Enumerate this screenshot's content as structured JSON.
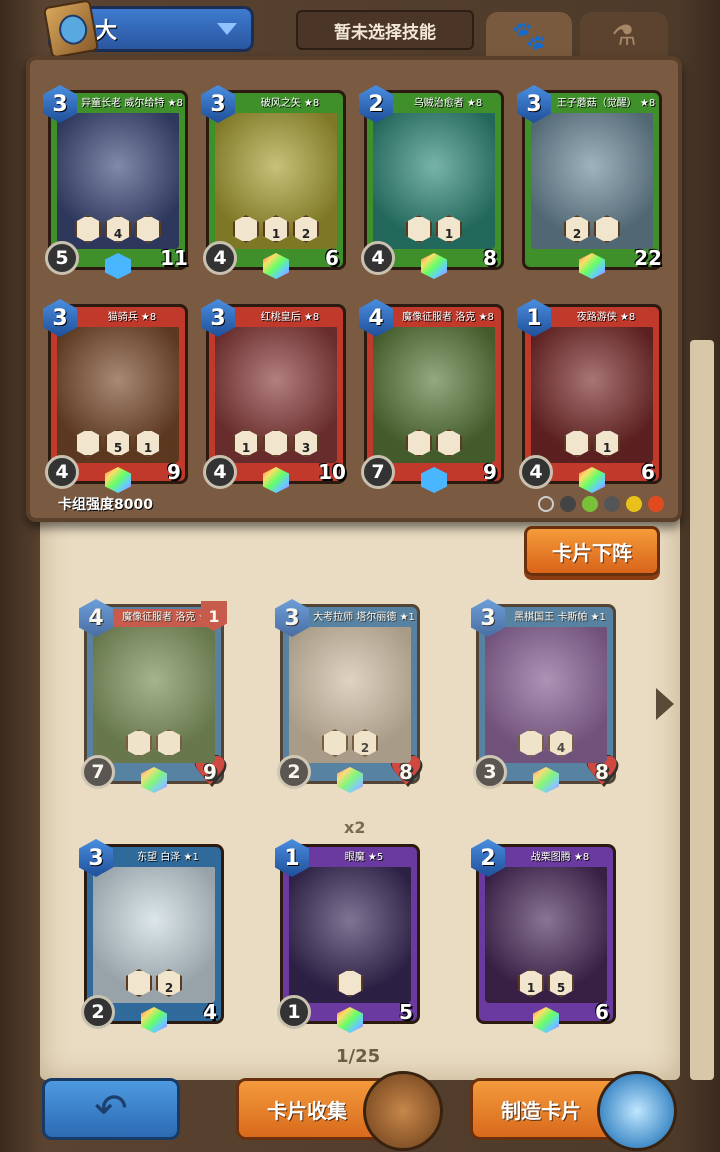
{
  "header": {
    "deck_name": "大",
    "skill_label": "暂未选择技能",
    "tabs": [
      {
        "icon": "paw-icon",
        "label": "🐾",
        "active": true
      },
      {
        "icon": "potion-icon",
        "label": "⚗",
        "active": false
      }
    ]
  },
  "deck": {
    "strength_label": "卡组强度8000",
    "cards": [
      {
        "name": "异童长老 威尔给特 ★8",
        "cost": "3",
        "attack": "5",
        "health": "11",
        "abilities": [
          "",
          "4",
          ""
        ],
        "banner": "#3f8f2a",
        "art": "#3d4a7a",
        "frame": "#3f8f2a",
        "gem": "#49b6ff"
      },
      {
        "name": "破风之矢 ★8",
        "cost": "3",
        "attack": "4",
        "health": "6",
        "abilities": [
          "",
          "1",
          "2"
        ],
        "banner": "#3f8f2a",
        "art": "#a8a032",
        "frame": "#3f8f2a",
        "gem": "rainbow"
      },
      {
        "name": "乌贼治愈者 ★8",
        "cost": "2",
        "attack": "4",
        "health": "8",
        "abilities": [
          "",
          "1"
        ],
        "banner": "#3f8f2a",
        "art": "#2f8a7a",
        "frame": "#3f8f2a",
        "gem": "rainbow"
      },
      {
        "name": "王子蘑菇（觉醒） ★8",
        "cost": "3",
        "attack": "",
        "health": "22",
        "abilities": [
          "2",
          ""
        ],
        "banner": "#3f8f2a",
        "art": "#6c8a9a",
        "frame": "#3f8f2a",
        "gem": "rainbow"
      },
      {
        "name": "猫骑兵 ★8",
        "cost": "3",
        "attack": "4",
        "health": "9",
        "abilities": [
          "",
          "5",
          "1"
        ],
        "banner": "#c0392b",
        "art": "#7a4a2a",
        "frame": "#c0392b",
        "gem": "rainbow"
      },
      {
        "name": "红桃皇后 ★8",
        "cost": "3",
        "attack": "4",
        "health": "10",
        "abilities": [
          "1",
          "",
          "3"
        ],
        "banner": "#c0392b",
        "art": "#8a3a3a",
        "frame": "#c0392b",
        "gem": "rainbow"
      },
      {
        "name": "魔像征服者 洛克 ★8",
        "cost": "4",
        "attack": "7",
        "health": "9",
        "abilities": [
          "",
          ""
        ],
        "banner": "#c0392b",
        "art": "#5a7a3a",
        "frame": "#c0392b",
        "gem": "#49b6ff"
      },
      {
        "name": "夜路游侠 ★8",
        "cost": "1",
        "attack": "4",
        "health": "6",
        "abilities": [
          "",
          "1"
        ],
        "banner": "#c0392b",
        "art": "#7a2a2a",
        "frame": "#c0392b",
        "gem": "rainbow"
      }
    ]
  },
  "unequip_label": "卡片下阵",
  "collection": {
    "copy_count": "x2",
    "page": "1/25",
    "cards": [
      {
        "name": "魔像征服者 洛克 ★8",
        "cost": "4",
        "attack": "7",
        "health": "9",
        "badge": "1",
        "abilities": [
          "",
          ""
        ],
        "banner": "#c0392b",
        "art": "#5a7a3a",
        "frame": "#2f6a9a",
        "faded": true
      },
      {
        "name": "大考拉师 塔尔丽德 ★1",
        "cost": "3",
        "attack": "2",
        "health": "8",
        "abilities": [
          "",
          "2"
        ],
        "banner": "#2f6a9a",
        "art": "#c9b9a0",
        "frame": "#2f6a9a",
        "faded": true
      },
      {
        "name": "黑棋国王 卡斯帕 ★1",
        "cost": "3",
        "attack": "3",
        "health": "8",
        "abilities": [
          "",
          "4"
        ],
        "banner": "#2f6a9a",
        "art": "#6a3a8a",
        "frame": "#2f6a9a",
        "faded": true
      },
      {
        "name": "东望 白泽 ★1",
        "cost": "3",
        "attack": "2",
        "health": "4",
        "abilities": [
          "",
          "2"
        ],
        "banner": "#2f6a9a",
        "art": "#c9d9e0",
        "frame": "#2f6a9a",
        "faded": false
      },
      {
        "name": "眼魔 ★5",
        "cost": "1",
        "attack": "1",
        "health": "5",
        "abilities": [
          ""
        ],
        "banner": "#6a3aa0",
        "art": "#3a2a5a",
        "frame": "#6a3aa0",
        "faded": false
      },
      {
        "name": "战栗图腾 ★8",
        "cost": "2",
        "attack": "",
        "health": "6",
        "abilities": [
          "1",
          "5"
        ],
        "banner": "#6a3aa0",
        "art": "#4a2a5a",
        "frame": "#6a3aa0",
        "faded": false
      }
    ]
  },
  "bottom": {
    "collection_label": "卡片收集",
    "craft_label": "制造卡片",
    "back_icon": "↶"
  }
}
